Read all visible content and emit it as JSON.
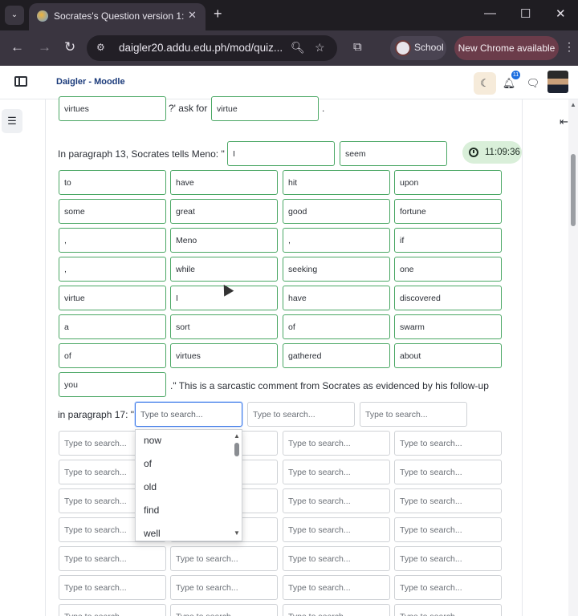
{
  "browser": {
    "tab_title": "Socrates's Question version 1: E",
    "url": "daigler20.addu.edu.ph/mod/quiz...",
    "profile_name": "School",
    "update_label": "New Chrome available"
  },
  "moodle": {
    "brand": "Daigler - Moodle",
    "notification_count": "11"
  },
  "timer": "11:09:36",
  "question": {
    "top_answer_1": "virtues",
    "top_mid_text": "?' ask for",
    "top_answer_2": "virtue",
    "top_end": ".",
    "para13_prefix": "In paragraph 13, Socrates tells Meno: \"",
    "row1": [
      "I",
      "seem"
    ],
    "grid": [
      [
        "to",
        "have",
        "hit",
        "upon"
      ],
      [
        "some",
        "great",
        "good",
        "fortune"
      ],
      [
        ",",
        "Meno",
        ",",
        "if"
      ],
      [
        ",",
        "while",
        "seeking",
        "one"
      ],
      [
        "virtue",
        "I",
        "have",
        "discovered"
      ],
      [
        "a",
        "sort",
        "of",
        "swarm"
      ],
      [
        "of",
        "virtues",
        "gathered",
        "about"
      ]
    ],
    "last_answer": "you",
    "sarcasm_text": ".\" This is a sarcastic comment from Socrates as evidenced by his follow-up",
    "para17_prefix": "in paragraph 17: \"",
    "placeholder": "Type to search..."
  },
  "dropdown": {
    "options": [
      "now",
      "of",
      "old",
      "find",
      "well"
    ]
  }
}
